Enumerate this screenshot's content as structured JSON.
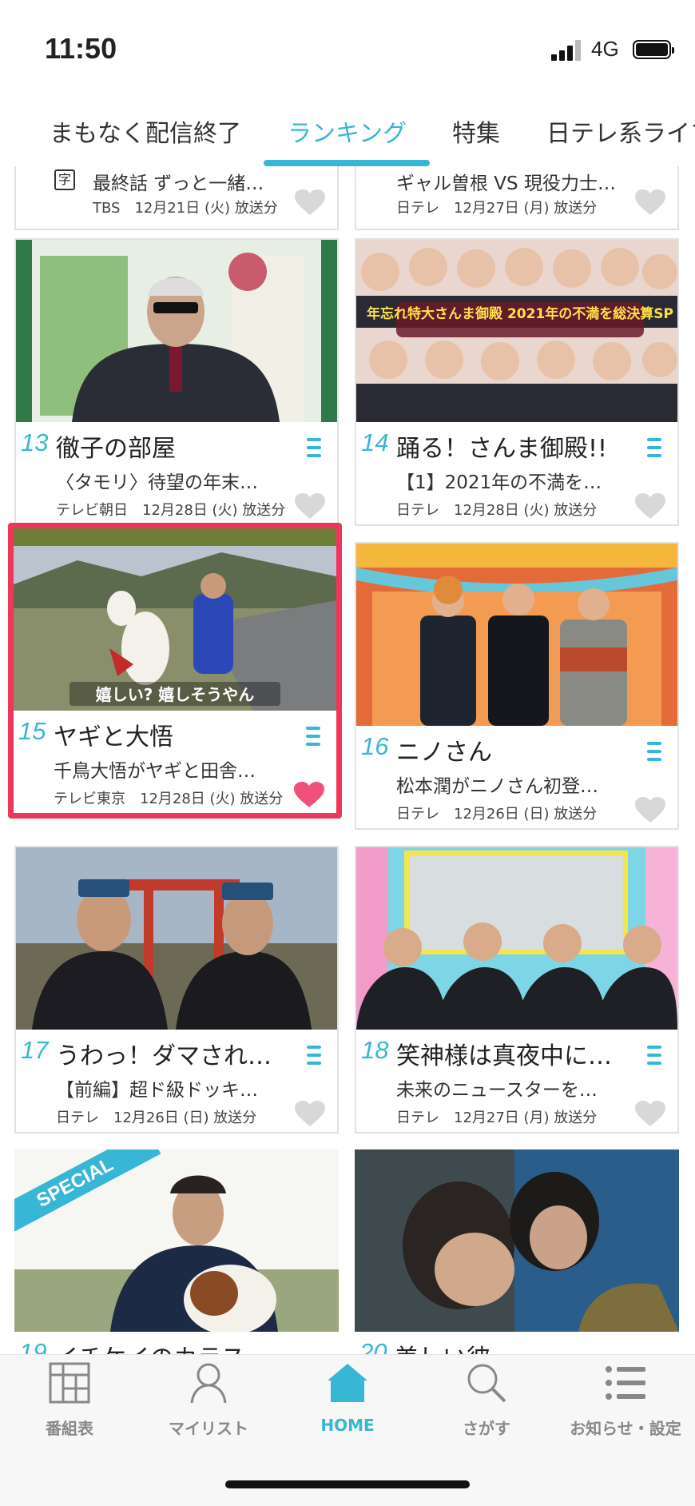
{
  "status_bar": {
    "time": "11:50",
    "network": "4G"
  },
  "tabs": [
    {
      "label": "まもなく配信終了",
      "active": false
    },
    {
      "label": "ランキング",
      "active": true
    },
    {
      "label": "特集",
      "active": false
    },
    {
      "label": "日テレ系ライブ",
      "active": false
    }
  ],
  "partial_cards": [
    {
      "subtitle": "最終話 ずっと一緒…",
      "broadcast": "TBS　12月21日 (火) 放送分",
      "favorited": false,
      "subs_badge": "字"
    },
    {
      "subtitle": "ギャル曽根 VS 現役力士…",
      "broadcast": "日テレ　12月27日 (月) 放送分",
      "favorited": false
    }
  ],
  "cards": [
    {
      "rank": "13",
      "title": "徹子の部屋",
      "subtitle": "〈タモリ〉待望の年末…",
      "broadcast": "テレビ朝日　12月28日 (火) 放送分",
      "favorited": false,
      "selected": false
    },
    {
      "rank": "14",
      "title": "踊る！さんま御殿!!",
      "subtitle": "【1】2021年の不満を…",
      "broadcast": "日テレ　12月28日 (火) 放送分",
      "favorited": false,
      "selected": false,
      "thumb_caption": "年忘れ特大さんま御殿 2021年の不満を総決算SP"
    },
    {
      "rank": "15",
      "title": "ヤギと大悟",
      "subtitle": "千鳥大悟がヤギと田舎…",
      "broadcast": "テレビ東京　12月28日 (火) 放送分",
      "favorited": true,
      "selected": true,
      "thumb_caption": "嬉しい? 嬉しそうやん"
    },
    {
      "rank": "16",
      "title": "ニノさん",
      "subtitle": "松本潤がニノさん初登…",
      "broadcast": "日テレ　12月26日 (日) 放送分",
      "favorited": false,
      "selected": false
    },
    {
      "rank": "17",
      "title": "うわっ！ダマされ…",
      "subtitle": "【前編】超ド級ドッキ…",
      "broadcast": "日テレ　12月26日 (日) 放送分",
      "favorited": false,
      "selected": false
    },
    {
      "rank": "18",
      "title": "笑神様は真夜中に…",
      "subtitle": "未来のニュースターを…",
      "broadcast": "日テレ　12月27日 (月) 放送分",
      "favorited": false,
      "selected": false
    },
    {
      "rank": "19",
      "title": "イチケイのカラス",
      "special_badge": "SPECIAL"
    },
    {
      "rank": "20",
      "title": "美しい彼"
    }
  ],
  "bottom_nav": [
    {
      "label": "番組表",
      "icon": "grid-schedule-icon",
      "active": false
    },
    {
      "label": "マイリスト",
      "icon": "person-icon",
      "active": false
    },
    {
      "label": "HOME",
      "icon": "home-icon",
      "active": true
    },
    {
      "label": "さがす",
      "icon": "search-icon",
      "active": false
    },
    {
      "label": "お知らせ・設定",
      "icon": "list-settings-icon",
      "active": false
    }
  ],
  "colors": {
    "accent": "#38b6d6",
    "selected_border": "#f0365a",
    "heart_active": "#f0507a",
    "heart_inactive": "#d8d8d8"
  }
}
